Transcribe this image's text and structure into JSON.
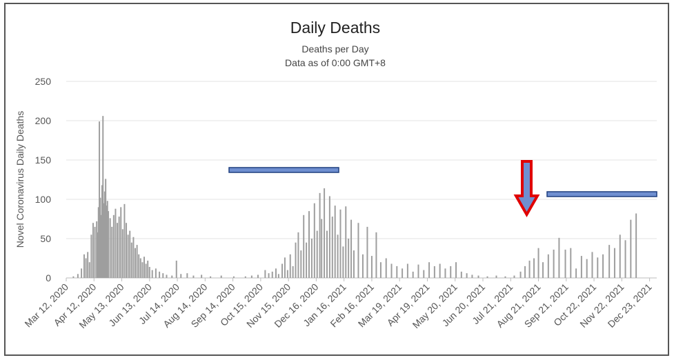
{
  "chart_data": {
    "type": "bar",
    "title": "Daily Deaths",
    "subtitle_lines": [
      "Deaths per Day",
      "Data as of 0:00 GMT+8"
    ],
    "ylabel": "Novel Coronavirus Daily Deaths",
    "xlabel": "",
    "ylim": [
      0,
      250
    ],
    "yticks": [
      0,
      50,
      100,
      150,
      200,
      250
    ],
    "grid": true,
    "bar_color": "#9e9e9e",
    "x_start": "2020-03-12",
    "x_end": "2021-12-31",
    "xtick_labels": [
      "Mar 12, 2020",
      "Apr 12, 2020",
      "May 13, 2020",
      "Jun 13, 2020",
      "Jul 14, 2020",
      "Aug 14, 2020",
      "Sep 14, 2020",
      "Oct 15, 2020",
      "Nov 15, 2020",
      "Dec 16, 2020",
      "Jan 16, 2021",
      "Feb 16, 2021",
      "Mar 19, 2021",
      "Apr 19, 2021",
      "May 20, 2021",
      "Jun 20, 2021",
      "Jul 21, 2021",
      "Aug 21, 2021",
      "Sep 21, 2021",
      "Oct 22, 2021",
      "Nov 22, 2021",
      "Dec 23, 2021"
    ],
    "series": [
      {
        "points": [
          [
            "2020-03-20",
            2
          ],
          [
            "2020-03-25",
            5
          ],
          [
            "2020-03-29",
            12
          ],
          [
            "2020-04-01",
            30
          ],
          [
            "2020-04-03",
            25
          ],
          [
            "2020-04-05",
            33
          ],
          [
            "2020-04-07",
            20
          ],
          [
            "2020-04-09",
            55
          ],
          [
            "2020-04-11",
            70
          ],
          [
            "2020-04-13",
            65
          ],
          [
            "2020-04-15",
            72
          ],
          [
            "2020-04-16",
            58
          ],
          [
            "2020-04-17",
            90
          ],
          [
            "2020-04-18",
            199
          ],
          [
            "2020-04-19",
            102
          ],
          [
            "2020-04-20",
            80
          ],
          [
            "2020-04-21",
            118
          ],
          [
            "2020-04-22",
            206
          ],
          [
            "2020-04-23",
            95
          ],
          [
            "2020-04-24",
            110
          ],
          [
            "2020-04-25",
            126
          ],
          [
            "2020-04-26",
            92
          ],
          [
            "2020-04-27",
            98
          ],
          [
            "2020-04-28",
            85
          ],
          [
            "2020-04-30",
            76
          ],
          [
            "2020-05-02",
            65
          ],
          [
            "2020-05-04",
            80
          ],
          [
            "2020-05-06",
            88
          ],
          [
            "2020-05-08",
            70
          ],
          [
            "2020-05-10",
            78
          ],
          [
            "2020-05-12",
            90
          ],
          [
            "2020-05-14",
            62
          ],
          [
            "2020-05-16",
            94
          ],
          [
            "2020-05-18",
            70
          ],
          [
            "2020-05-20",
            55
          ],
          [
            "2020-05-22",
            60
          ],
          [
            "2020-05-24",
            45
          ],
          [
            "2020-05-26",
            52
          ],
          [
            "2020-05-28",
            38
          ],
          [
            "2020-05-30",
            42
          ],
          [
            "2020-06-01",
            30
          ],
          [
            "2020-06-03",
            25
          ],
          [
            "2020-06-05",
            20
          ],
          [
            "2020-06-07",
            27
          ],
          [
            "2020-06-09",
            18
          ],
          [
            "2020-06-11",
            22
          ],
          [
            "2020-06-13",
            14
          ],
          [
            "2020-06-16",
            10
          ],
          [
            "2020-06-20",
            12
          ],
          [
            "2020-06-24",
            8
          ],
          [
            "2020-06-28",
            6
          ],
          [
            "2020-07-02",
            4
          ],
          [
            "2020-07-08",
            3
          ],
          [
            "2020-07-13",
            22
          ],
          [
            "2020-07-18",
            5
          ],
          [
            "2020-07-25",
            6
          ],
          [
            "2020-08-01",
            3
          ],
          [
            "2020-08-10",
            4
          ],
          [
            "2020-08-20",
            2
          ],
          [
            "2020-09-01",
            3
          ],
          [
            "2020-09-15",
            2
          ],
          [
            "2020-09-28",
            2
          ],
          [
            "2020-10-05",
            3
          ],
          [
            "2020-10-12",
            4
          ],
          [
            "2020-10-20",
            10
          ],
          [
            "2020-10-24",
            6
          ],
          [
            "2020-10-28",
            8
          ],
          [
            "2020-11-01",
            12
          ],
          [
            "2020-11-04",
            5
          ],
          [
            "2020-11-08",
            18
          ],
          [
            "2020-11-11",
            26
          ],
          [
            "2020-11-14",
            10
          ],
          [
            "2020-11-17",
            30
          ],
          [
            "2020-11-20",
            15
          ],
          [
            "2020-11-23",
            45
          ],
          [
            "2020-11-26",
            58
          ],
          [
            "2020-11-29",
            35
          ],
          [
            "2020-12-02",
            80
          ],
          [
            "2020-12-05",
            45
          ],
          [
            "2020-12-08",
            85
          ],
          [
            "2020-12-11",
            50
          ],
          [
            "2020-12-14",
            95
          ],
          [
            "2020-12-17",
            60
          ],
          [
            "2020-12-20",
            108
          ],
          [
            "2020-12-22",
            75
          ],
          [
            "2020-12-25",
            114
          ],
          [
            "2020-12-28",
            60
          ],
          [
            "2020-12-31",
            104
          ],
          [
            "2021-01-03",
            78
          ],
          [
            "2021-01-06",
            92
          ],
          [
            "2021-01-09",
            55
          ],
          [
            "2021-01-12",
            87
          ],
          [
            "2021-01-15",
            40
          ],
          [
            "2021-01-18",
            91
          ],
          [
            "2021-01-21",
            50
          ],
          [
            "2021-01-24",
            74
          ],
          [
            "2021-01-27",
            35
          ],
          [
            "2021-02-01",
            70
          ],
          [
            "2021-02-06",
            30
          ],
          [
            "2021-02-11",
            65
          ],
          [
            "2021-02-16",
            28
          ],
          [
            "2021-02-21",
            58
          ],
          [
            "2021-02-26",
            20
          ],
          [
            "2021-03-04",
            25
          ],
          [
            "2021-03-10",
            18
          ],
          [
            "2021-03-16",
            15
          ],
          [
            "2021-03-22",
            12
          ],
          [
            "2021-03-28",
            18
          ],
          [
            "2021-04-03",
            8
          ],
          [
            "2021-04-09",
            17
          ],
          [
            "2021-04-15",
            10
          ],
          [
            "2021-04-21",
            20
          ],
          [
            "2021-04-27",
            15
          ],
          [
            "2021-05-03",
            18
          ],
          [
            "2021-05-09",
            12
          ],
          [
            "2021-05-15",
            15
          ],
          [
            "2021-05-21",
            20
          ],
          [
            "2021-05-27",
            8
          ],
          [
            "2021-06-02",
            6
          ],
          [
            "2021-06-08",
            4
          ],
          [
            "2021-06-15",
            3
          ],
          [
            "2021-06-25",
            2
          ],
          [
            "2021-07-05",
            3
          ],
          [
            "2021-07-15",
            2
          ],
          [
            "2021-07-25",
            3
          ],
          [
            "2021-08-01",
            8
          ],
          [
            "2021-08-06",
            15
          ],
          [
            "2021-08-11",
            22
          ],
          [
            "2021-08-16",
            25
          ],
          [
            "2021-08-21",
            38
          ],
          [
            "2021-08-26",
            20
          ],
          [
            "2021-09-01",
            30
          ],
          [
            "2021-09-07",
            36
          ],
          [
            "2021-09-13",
            51
          ],
          [
            "2021-09-20",
            36
          ],
          [
            "2021-09-26",
            38
          ],
          [
            "2021-10-02",
            12
          ],
          [
            "2021-10-08",
            28
          ],
          [
            "2021-10-14",
            24
          ],
          [
            "2021-10-20",
            33
          ],
          [
            "2021-10-26",
            26
          ],
          [
            "2021-11-01",
            30
          ],
          [
            "2021-11-08",
            42
          ],
          [
            "2021-11-14",
            38
          ],
          [
            "2021-11-20",
            55
          ],
          [
            "2021-11-26",
            48
          ],
          [
            "2021-12-02",
            74
          ],
          [
            "2021-12-08",
            82
          ]
        ]
      }
    ]
  },
  "annotations": {
    "bar_color": "#6f8fd0",
    "bar_stroke": "#1f3f7f",
    "arrow_fill": "#6f8fd0",
    "arrow_stroke": "#e00000"
  }
}
